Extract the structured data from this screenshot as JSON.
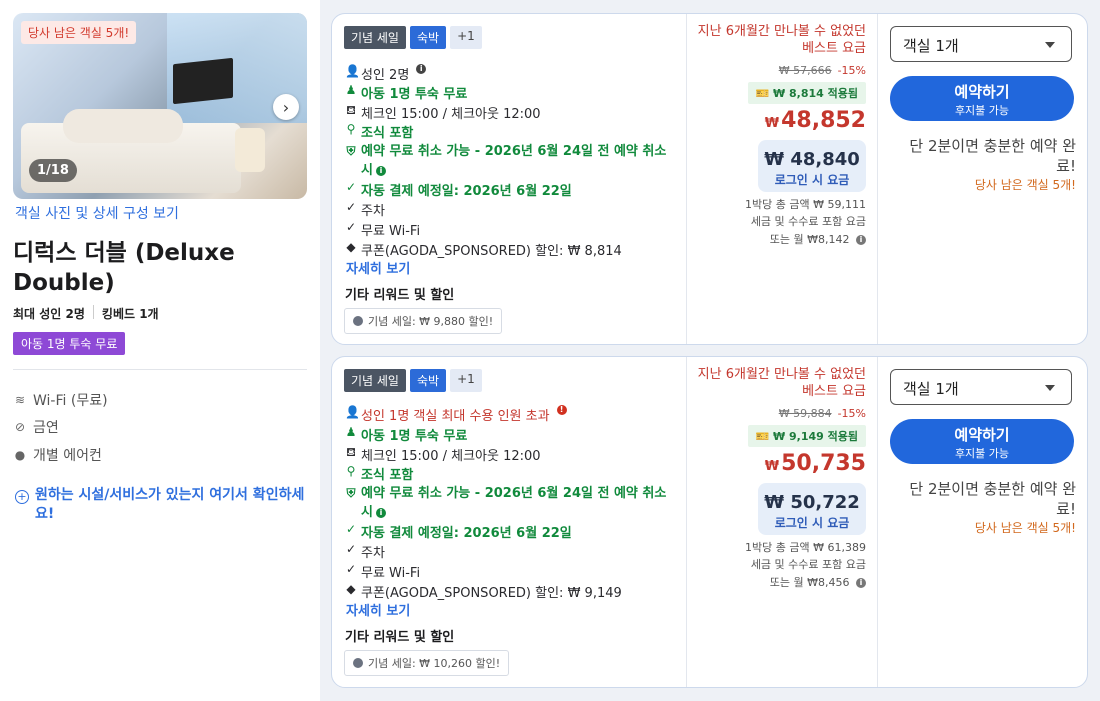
{
  "room": {
    "photo_badge": "당사 남은 객실 5개!",
    "photo_counter": "1/18",
    "photo_link": "객실 사진 및 상세 구성 보기",
    "title": "디럭스 더블 (Deluxe Double)",
    "max_guests": "최대 성인 2명",
    "bed": "킹베드 1개",
    "child_tag": "아동 1명 투숙 무료",
    "amenities": [
      {
        "icon": "wifi-icon",
        "label": "Wi-Fi (무료)"
      },
      {
        "icon": "no-smoking-icon",
        "label": "금연"
      },
      {
        "icon": "check-circle-icon",
        "label": "개별 에어컨"
      }
    ],
    "ask_link": "원하는 시설/서비스가 있는지 여기서 확인하세요!"
  },
  "offers": [
    {
      "tags": [
        "기념 세일",
        "숙박",
        "+1"
      ],
      "guests": "성인 2명",
      "child": "아동 1명 투숙 무료",
      "checkin": "체크인 15:00 / 체크아웃 12:00",
      "breakfast": "조식 포함",
      "cancel": "예약 무료 취소 가능 - 2026년 6월 24일 전 예약 취소 시",
      "payment": "자동 결제 예정일: 2026년 6월 22일",
      "parking": "주차",
      "wifi": "무료 Wi-Fi",
      "coupon": "쿠폰(AGODA_SPONSORED) 할인: ₩ 8,814",
      "details_link": "자세히 보기",
      "rewards_title": "기타 리워드 및 할인",
      "reward_chip": "기념 세일: ₩ 9,880 할인!",
      "best_price_note": "지난 6개월간 만나볼 수 없었던 베스트 요금",
      "old_price": "₩ 57,666",
      "discount": "-15%",
      "applied": "₩ 8,814 적용됨",
      "currency": "₩",
      "price": "48,852",
      "login_price": "₩ 48,840",
      "login_label": "로그인 시 요금",
      "total": "1박당 총 금액 ₩ 59,111",
      "tax_note": "세금 및 수수료 포함 요금",
      "monthly": "또는 월 ₩8,142",
      "room_select": "객실 1개",
      "book_label": "예약하기",
      "book_sub": "후지불 가능",
      "hurry": "단 2분이면 충분한 예약 완료!",
      "rooms_left": "당사 남은 객실 5개!"
    },
    {
      "tags": [
        "기념 세일",
        "숙박",
        "+1"
      ],
      "guests": "성인 1명 객실 최대 수용 인원 초과",
      "child": "아동 1명 투숙 무료",
      "checkin": "체크인 15:00 / 체크아웃 12:00",
      "breakfast": "조식 포함",
      "cancel": "예약 무료 취소 가능 - 2026년 6월 24일 전 예약 취소 시",
      "payment": "자동 결제 예정일: 2026년 6월 22일",
      "parking": "주차",
      "wifi": "무료 Wi-Fi",
      "coupon": "쿠폰(AGODA_SPONSORED) 할인: ₩ 9,149",
      "details_link": "자세히 보기",
      "rewards_title": "기타 리워드 및 할인",
      "reward_chip": "기념 세일: ₩ 10,260 할인!",
      "best_price_note": "지난 6개월간 만나볼 수 없었던 베스트 요금",
      "old_price": "₩ 59,884",
      "discount": "-15%",
      "applied": "₩ 9,149 적용됨",
      "currency": "₩",
      "price": "50,735",
      "login_price": "₩ 50,722",
      "login_label": "로그인 시 요금",
      "total": "1박당 총 금액 ₩ 61,389",
      "tax_note": "세금 및 수수료 포함 요금",
      "monthly": "또는 월 ₩8,456",
      "room_select": "객실 1개",
      "book_label": "예약하기",
      "book_sub": "후지불 가능",
      "hurry": "단 2분이면 충분한 예약 완료!",
      "rooms_left": "당사 남은 객실 5개!"
    }
  ],
  "colors": {
    "accent": "#2167dc",
    "price_red": "#c4372d",
    "green": "#118a3c",
    "purple": "#8e49d6"
  }
}
